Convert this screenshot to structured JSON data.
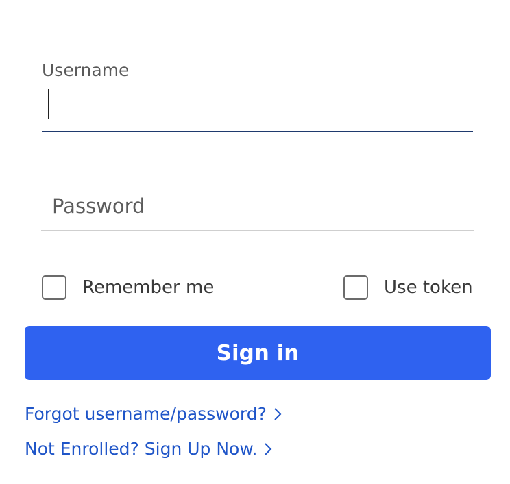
{
  "form": {
    "username": {
      "label": "Username",
      "value": ""
    },
    "password": {
      "placeholder": "Password",
      "value": ""
    },
    "remember_me": {
      "label": "Remember me",
      "checked": false
    },
    "use_token": {
      "label": "Use token",
      "checked": false
    },
    "signin_label": "Sign in"
  },
  "links": {
    "forgot": "Forgot username/password?",
    "enroll": "Not Enrolled? Sign Up Now."
  },
  "colors": {
    "primary": "#2f62f0",
    "link": "#1f55c8",
    "focus_underline": "#1f3a6e"
  },
  "icons": {
    "chevron": "chevron-right-icon"
  }
}
